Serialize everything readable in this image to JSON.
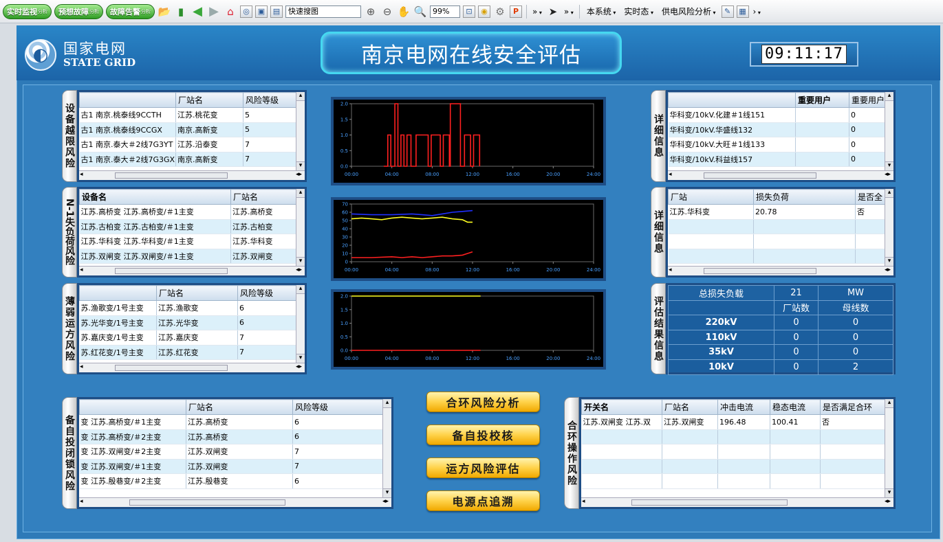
{
  "toolbar": {
    "btn_monitor": "实时监视",
    "btn_monitor_sub": "分析",
    "btn_contingency": "预想故障",
    "btn_contingency_sub": "分析",
    "btn_fault": "故障告警",
    "btn_fault_sub": "分析",
    "search_value": "快速搜图",
    "zoom_value": "99%",
    "menu_system": "本系统",
    "menu_state": "实时态",
    "menu_analysis": "供电风险分析",
    "more1": "»",
    "more2": "»",
    "more3": "›"
  },
  "header": {
    "logo_cn": "国家电网",
    "logo_en": "STATE GRID",
    "title": "南京电网在线安全评估",
    "clock": "09:11:17"
  },
  "p1": {
    "tab": "设备越限风险",
    "cols": [
      "",
      "厂站名",
      "风险等级"
    ],
    "rows": [
      [
        "古1 南京.桃泰线9CCTH",
        "江苏.桃花变",
        "5"
      ],
      [
        "古1 南京.桃泰线9CCGX",
        "南京.高新变",
        "5"
      ],
      [
        "古1 南京.泰大＃2线7G3YT",
        "江苏.沿泰变",
        "7"
      ],
      [
        "古1 南京.泰大＃2线7G3GX",
        "南京.高新变",
        "7"
      ]
    ]
  },
  "p2": {
    "tab": "N-1失负荷风险",
    "cols": [
      "设备名",
      "厂站名"
    ],
    "rows": [
      [
        "江苏.高桥变 江苏.高桥变/＃1主变",
        "江苏.高桥变"
      ],
      [
        "江苏.古柏变 江苏.古柏变/＃1主变",
        "江苏.古柏变"
      ],
      [
        "江苏.华科变 江苏.华科变/＃1主变",
        "江苏.华科变"
      ],
      [
        "江苏.双闸变 江苏.双闸变/＃1主变",
        "江苏.双闸变"
      ]
    ]
  },
  "p3": {
    "tab": "薄弱运方风险",
    "cols": [
      "",
      "厂站名",
      "风险等级"
    ],
    "rows": [
      [
        "苏.渔歌变/1号主变",
        "江苏.渔歌变",
        "6"
      ],
      [
        "苏.光华变/1号主变",
        "江苏.光华变",
        "6"
      ],
      [
        "苏.嘉庆变/1号主变",
        "江苏.嘉庆变",
        "7"
      ],
      [
        "苏.红花变/1号主变",
        "江苏.红花变",
        "7"
      ]
    ]
  },
  "p4": {
    "tab": "备自投闭锁风险",
    "cols": [
      "",
      "厂站名",
      "风险等级"
    ],
    "rows": [
      [
        "变 江苏.高桥变/＃1主变",
        "江苏.高桥变",
        "6"
      ],
      [
        "变 江苏.高桥变/＃2主变",
        "江苏.高桥变",
        "6"
      ],
      [
        "变 江苏.双闸变/＃2主变",
        "江苏.双闸变",
        "7"
      ],
      [
        "变 江苏.双闸变/＃1主变",
        "江苏.双闸变",
        "7"
      ],
      [
        "变 江苏.殷巷变/＃2主变",
        "江苏.殷巷变",
        "6"
      ]
    ]
  },
  "p5": {
    "tab": "详细信息",
    "cols": [
      "",
      "重要用户",
      "重要用户"
    ],
    "rows": [
      [
        "华科变/10kV.化建＃1线151",
        "",
        "0"
      ],
      [
        "华科变/10kV.华盛线132",
        "",
        "0"
      ],
      [
        "华科变/10kV.大旺＃1线133",
        "",
        "0"
      ],
      [
        "华科变/10kV.科益线157",
        "",
        "0"
      ]
    ]
  },
  "p6": {
    "tab": "详细信息",
    "cols": [
      "厂站",
      "损失负荷",
      "是否全"
    ],
    "rows": [
      [
        "江苏.华科变",
        "20.78",
        "否"
      ],
      [
        "",
        "",
        ""
      ],
      [
        "",
        "",
        ""
      ],
      [
        "",
        "",
        ""
      ]
    ]
  },
  "p7": {
    "tab": "评估结果信息",
    "total_label": "总损失负载",
    "total_value": "21",
    "total_unit": "MW",
    "col_station": "厂站数",
    "col_bus": "母线数",
    "rows": [
      {
        "level": "220kV",
        "stations": "0",
        "buses": "0"
      },
      {
        "level": "110kV",
        "stations": "0",
        "buses": "0"
      },
      {
        "level": "35kV",
        "stations": "0",
        "buses": "0"
      },
      {
        "level": "10kV",
        "stations": "0",
        "buses": "2"
      }
    ]
  },
  "p8": {
    "tab": "合环操作风险",
    "cols": [
      "开关名",
      "厂站名",
      "冲击电流",
      "稳态电流",
      "是否满足合环"
    ],
    "rows": [
      [
        "江苏.双闸变 江苏.双",
        "江苏.双闸变",
        "196.48",
        "100.41",
        "否"
      ],
      [
        "",
        "",
        "",
        "",
        ""
      ],
      [
        "",
        "",
        "",
        "",
        ""
      ],
      [
        "",
        "",
        "",
        "",
        ""
      ],
      [
        "",
        "",
        "",
        "",
        ""
      ]
    ]
  },
  "buttons": {
    "loop": "合环风险分析",
    "bzt": "备自投校核",
    "mode": "运方风险评估",
    "trace": "电源点追溯"
  },
  "charts": {
    "xticks": [
      "00:00",
      "04:00",
      "08:00",
      "12:00",
      "16:00",
      "20:00",
      "24:00"
    ],
    "c1_yticks": [
      "2.0",
      "1.5",
      "1.0",
      "0.5",
      "0.0"
    ],
    "c2_yticks": [
      "70",
      "60",
      "50",
      "40",
      "30",
      "20",
      "10",
      "0"
    ],
    "c3_yticks": [
      "2.0",
      "1.5",
      "1.0",
      "0.5",
      "0.0"
    ]
  },
  "chart_data": [
    {
      "type": "line",
      "xlim": [
        0,
        24
      ],
      "ylim": [
        0,
        2
      ],
      "series": [
        {
          "color": "#ff2020",
          "x": [
            3.2,
            3.6,
            3.6,
            3.9,
            3.9,
            4.3,
            4.3,
            4.6,
            4.6,
            4.9,
            4.9,
            5.2,
            5.2,
            5.5,
            5.5,
            5.9,
            5.9,
            6.4,
            6.4,
            7.6,
            7.6,
            7.9,
            7.9,
            8.8,
            8.8,
            9.1,
            9.1,
            9.7,
            9.7,
            9.8,
            9.8,
            10.8,
            10.8,
            11.2,
            11.2,
            11.8,
            11.8,
            12.1,
            12.1,
            12.7,
            12.7
          ],
          "y": [
            0,
            0,
            1,
            1,
            0,
            0,
            2,
            2,
            0,
            0,
            1,
            1,
            0,
            0,
            1,
            1,
            0,
            0,
            1,
            1,
            0,
            0,
            1,
            1,
            0,
            0,
            1,
            1,
            0,
            0,
            2,
            2,
            0,
            0,
            1,
            1,
            0,
            0,
            1,
            1,
            0
          ]
        }
      ]
    },
    {
      "type": "line",
      "xlim": [
        0,
        24
      ],
      "ylim": [
        0,
        70
      ],
      "series": [
        {
          "color": "#2030ff",
          "x": [
            0,
            2,
            4,
            6,
            7,
            8,
            9,
            10,
            11,
            12
          ],
          "y": [
            58,
            57,
            57,
            58,
            57,
            56,
            58,
            60,
            61,
            62
          ]
        },
        {
          "color": "#ffff20",
          "x": [
            0,
            1,
            2,
            3,
            4,
            5,
            6,
            7,
            8,
            9,
            10,
            11,
            11.5,
            12
          ],
          "y": [
            52,
            53,
            52,
            51,
            53,
            54,
            53,
            52,
            53,
            54,
            52,
            51,
            48,
            48
          ]
        },
        {
          "color": "#ff2020",
          "x": [
            0,
            2,
            4,
            5,
            6,
            7,
            8,
            9,
            10,
            11,
            11.5,
            12
          ],
          "y": [
            5,
            5,
            6,
            5,
            6,
            5,
            6,
            7,
            7,
            8,
            10,
            12
          ]
        }
      ]
    },
    {
      "type": "line",
      "xlim": [
        0,
        24
      ],
      "ylim": [
        0,
        2
      ],
      "series": [
        {
          "color": "#ffff20",
          "x": [
            0,
            12.8
          ],
          "y": [
            2,
            2
          ]
        },
        {
          "color": "#ff2020",
          "x": [
            0,
            12.8
          ],
          "y": [
            0,
            0
          ]
        }
      ]
    }
  ]
}
